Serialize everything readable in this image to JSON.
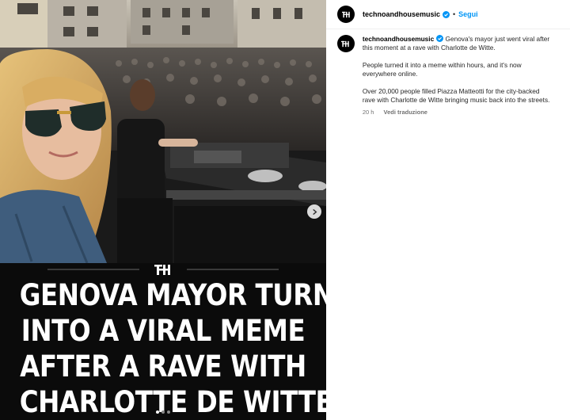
{
  "post": {
    "headline_lines": [
      "GENOVA MAYOR TURNS",
      "INTO A VIRAL MEME",
      "AFTER A RAVE WITH",
      "CHARLOTTE DE WITTE"
    ],
    "carousel_count": 3,
    "carousel_active": 1
  },
  "header": {
    "username": "technoandhousemusic",
    "separator": "•",
    "follow_label": "Segui"
  },
  "caption": {
    "username": "technoandhousemusic",
    "line1_rest": " Genova's mayor just went viral after",
    "line2": "this moment at a rave with Charlotte de Witte.",
    "para2_line1": "People turned it into a meme within hours, and it's now",
    "para2_line2": "everywhere online.",
    "para3_line1": "Over 20,000 people filled Piazza Matteotti for the city-backed",
    "para3_line2": "rave with Charlotte de Witte bringing music back into the streets."
  },
  "meta": {
    "time": "20 h",
    "translate_label": "Vedi traduzione"
  },
  "colors": {
    "follow_blue": "#0095f6",
    "verified_blue": "#0095f6"
  }
}
